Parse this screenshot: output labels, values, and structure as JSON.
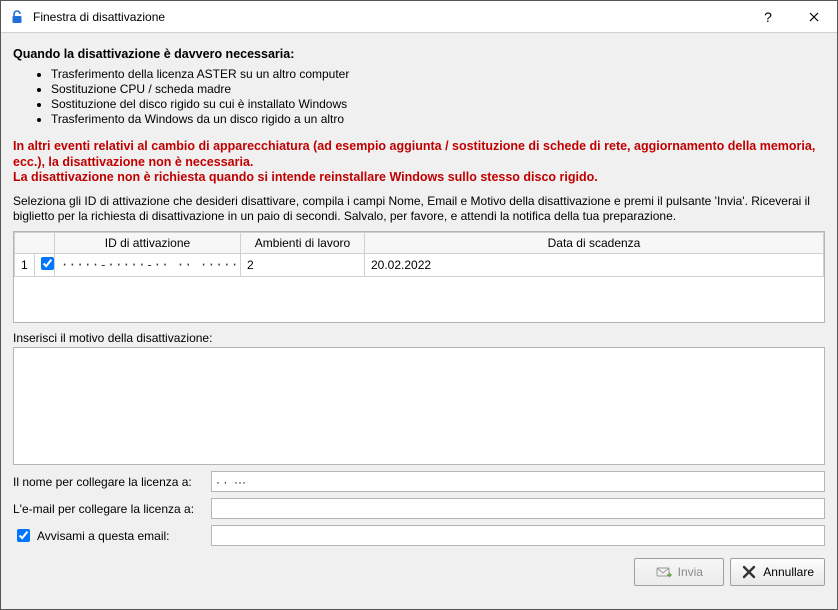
{
  "titlebar": {
    "title": "Finestra di disattivazione"
  },
  "heading": "Quando la disattivazione è davvero necessaria:",
  "cases": [
    "Trasferimento della licenza ASTER su un altro computer",
    "Sostituzione CPU / scheda madre",
    "Sostituzione del disco rigido su cui è installato Windows",
    "Trasferimento da Windows da un disco rigido a un altro"
  ],
  "warning_line1": "In altri eventi relativi al cambio di apparecchiatura (ad esempio aggiunta / sostituzione di schede di rete, aggiornamento della memoria, ecc.), la disattivazione non è necessaria.",
  "warning_line2": "La disattivazione non è richiesta quando si intende reinstallare Windows sullo stesso disco rigido.",
  "instructions": "Seleziona gli ID di attivazione che desideri disattivare, compila i campi Nome, Email e Motivo della disattivazione e premi il pulsante 'Invia'. Riceverai il biglietto per la richiesta di disattivazione in un paio di secondi. Salvalo, per favore, e attendi la notifica della tua preparazione.",
  "table": {
    "headers": {
      "activation_id": "ID di attivazione",
      "seats": "Ambienti di lavoro",
      "expiry": "Data di scadenza"
    },
    "rows": [
      {
        "num": "1",
        "checked": true,
        "activation_id": "·····-·····-··   ·· ····· ···   ·",
        "seats": "2",
        "expiry": "20.02.2022"
      }
    ]
  },
  "reason_label": "Inserisci il motivo della disattivazione:",
  "reason_value": "",
  "form": {
    "name_label": "Il nome per collegare la licenza a:",
    "name_value": "· ·  ···",
    "email_label": "L'e-mail per collegare la licenza a:",
    "email_value": "",
    "notify_label": "Avvisami a questa email:",
    "notify_checked": true,
    "notify_value": ""
  },
  "buttons": {
    "send": "Invia",
    "cancel": "Annullare"
  }
}
